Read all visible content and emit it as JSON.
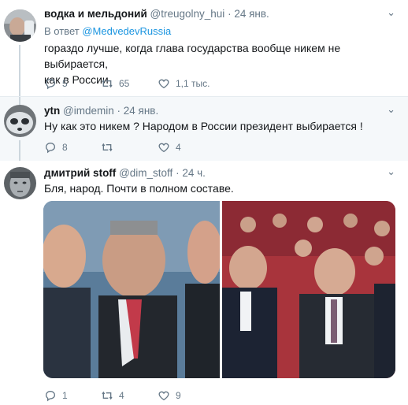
{
  "tweets": [
    {
      "name": "водка и мельдоний",
      "handle": "@treugolny_hui",
      "time": "24 янв.",
      "reply_prefix": "В ответ",
      "reply_to": "@MedvedevRussia",
      "text_line1": "гораздо лучше, когда глава государства вообще никем не выбирается,",
      "text_line2": "как в России",
      "replies": "5",
      "retweets": "65",
      "likes": "1,1 тыс."
    },
    {
      "name": "ytn",
      "handle": "@imdemin",
      "time": "24 янв.",
      "text": "Ну как это никем ? Народом в России президент выбирается !",
      "replies": "8",
      "retweets": "",
      "likes": "4"
    },
    {
      "name": "дмитрий stoff",
      "handle": "@dim_stoff",
      "time": "24 ч.",
      "text": "Бля, народ. Почти в полном составе.",
      "replies": "1",
      "retweets": "4",
      "likes": "9"
    }
  ],
  "separator": "·",
  "chevron": "⌄",
  "colors": {
    "accent": "#1b95e0",
    "muted": "#657786",
    "thread_line": "#ccd6dd"
  },
  "icons": [
    "reply-icon",
    "retweet-icon",
    "like-icon",
    "chevron-down-icon"
  ]
}
